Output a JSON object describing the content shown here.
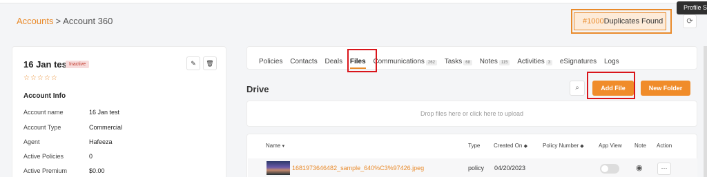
{
  "tooltip": "Profile Se",
  "breadcrumb": {
    "accounts": "Accounts",
    "sep": ">",
    "current": "Account 360"
  },
  "duplicates": {
    "count": "#1000",
    "label": "Duplicates Found"
  },
  "account": {
    "name": "16 Jan test",
    "status": "Inactive",
    "stars": "☆☆☆☆☆",
    "info_heading": "Account Info",
    "fields": [
      {
        "label": "Account name",
        "value": "16 Jan test"
      },
      {
        "label": "Account Type",
        "value": "Commercial"
      },
      {
        "label": "Agent",
        "value": "Hafeeza"
      },
      {
        "label": "Active Policies",
        "value": "0"
      },
      {
        "label": "Active Premium",
        "value": "$0.00"
      }
    ]
  },
  "tabs": [
    {
      "label": "Policies",
      "count": ""
    },
    {
      "label": "Contacts",
      "count": ""
    },
    {
      "label": "Deals",
      "count": ""
    },
    {
      "label": "Files",
      "count": ""
    },
    {
      "label": "Communications",
      "count": "262"
    },
    {
      "label": "Tasks",
      "count": "68"
    },
    {
      "label": "Notes",
      "count": "115"
    },
    {
      "label": "Activities",
      "count": "3"
    },
    {
      "label": "eSignatures",
      "count": ""
    },
    {
      "label": "Logs",
      "count": ""
    }
  ],
  "drive": {
    "title": "Drive",
    "add_file": "Add File",
    "new_folder": "New Folder",
    "dropzone": "Drop files here or click here to upload"
  },
  "table": {
    "headers": {
      "name": "Name",
      "type": "Type",
      "created": "Created On",
      "policy": "Policy Number",
      "appview": "App View",
      "note": "Note",
      "action": "Action"
    },
    "rows": [
      {
        "name": "1681973646482_sample_640%C3%97426.jpeg",
        "type": "policy",
        "created": "04/20/2023",
        "policy": "",
        "more": "···"
      }
    ]
  },
  "icons": {
    "refresh": "⟳",
    "edit": "✎",
    "delete": "🗑",
    "search": "⌕",
    "eye": "◉",
    "sort_both": "◆",
    "sort_down": "▾"
  }
}
